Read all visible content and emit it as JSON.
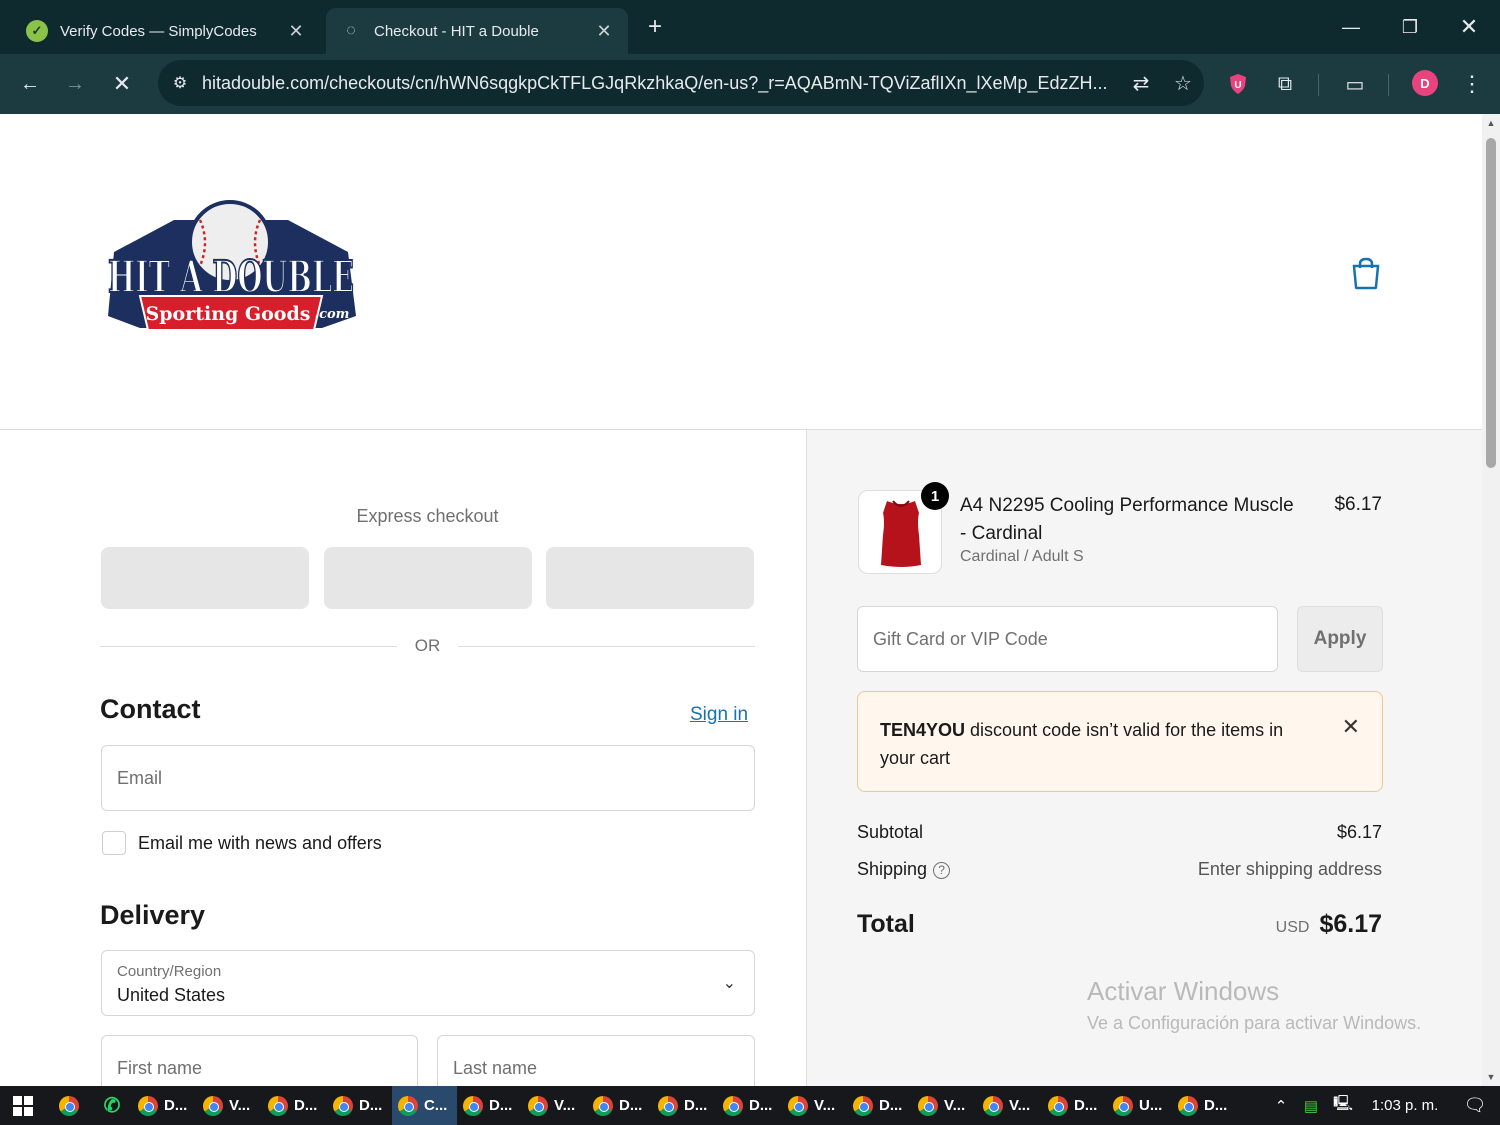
{
  "browser": {
    "tabs": [
      {
        "title": "Verify Codes — SimplyCodes",
        "active": false
      },
      {
        "title": "Checkout - HIT a Double",
        "active": true
      }
    ],
    "url": "hitadouble.com/checkouts/cn/hWN6sqgkpCkTFLGJqRkzhkaQ/en-us?_r=AQABmN-TQViZaflIXn_lXeMp_EdzZH...",
    "profile_initial": "D"
  },
  "store": {
    "logo_main": "HIT A DOUBLE",
    "logo_ribbon": "Sporting Goods",
    "logo_com": ".com"
  },
  "checkout": {
    "express_label": "Express checkout",
    "or_label": "OR",
    "contact": {
      "heading": "Contact",
      "sign_in": "Sign in",
      "email_placeholder": "Email",
      "newsletter_label": "Email me with news and offers"
    },
    "delivery": {
      "heading": "Delivery",
      "country_label": "Country/Region",
      "country_value": "United States",
      "first_name_placeholder": "First name",
      "last_name_placeholder": "Last name"
    }
  },
  "summary": {
    "item": {
      "quantity": "1",
      "name": "A4 N2295 Cooling Performance Muscle - Cardinal",
      "variant": "Cardinal / Adult S",
      "price": "$6.17",
      "color": "#b5121b"
    },
    "gift_placeholder": "Gift Card or VIP Code",
    "apply_label": "Apply",
    "alert": {
      "code": "TEN4YOU",
      "message": " discount code isn’t valid for the items in your cart"
    },
    "subtotal_label": "Subtotal",
    "subtotal_value": "$6.17",
    "shipping_label": "Shipping",
    "shipping_value": "Enter shipping address",
    "total_label": "Total",
    "total_currency": "USD",
    "total_value": "$6.17"
  },
  "watermark": {
    "line1": "Activar Windows",
    "line2": "Ve a Configuración para activar Windows."
  },
  "taskbar": {
    "items": [
      "D...",
      "V...",
      "D...",
      "D...",
      "C...",
      "D...",
      "V...",
      "D...",
      "D...",
      "D...",
      "V...",
      "D...",
      "V...",
      "V...",
      "D...",
      "U...",
      "D..."
    ],
    "active_index": 4,
    "time": "1:03 p. m."
  },
  "colors": {
    "accent_link": "#1773b0",
    "alert_border": "#f0c68f",
    "alert_bg": "#fff7ed",
    "chrome_dark": "#0f2a2e",
    "chrome_toolbar": "#1c3b40"
  }
}
